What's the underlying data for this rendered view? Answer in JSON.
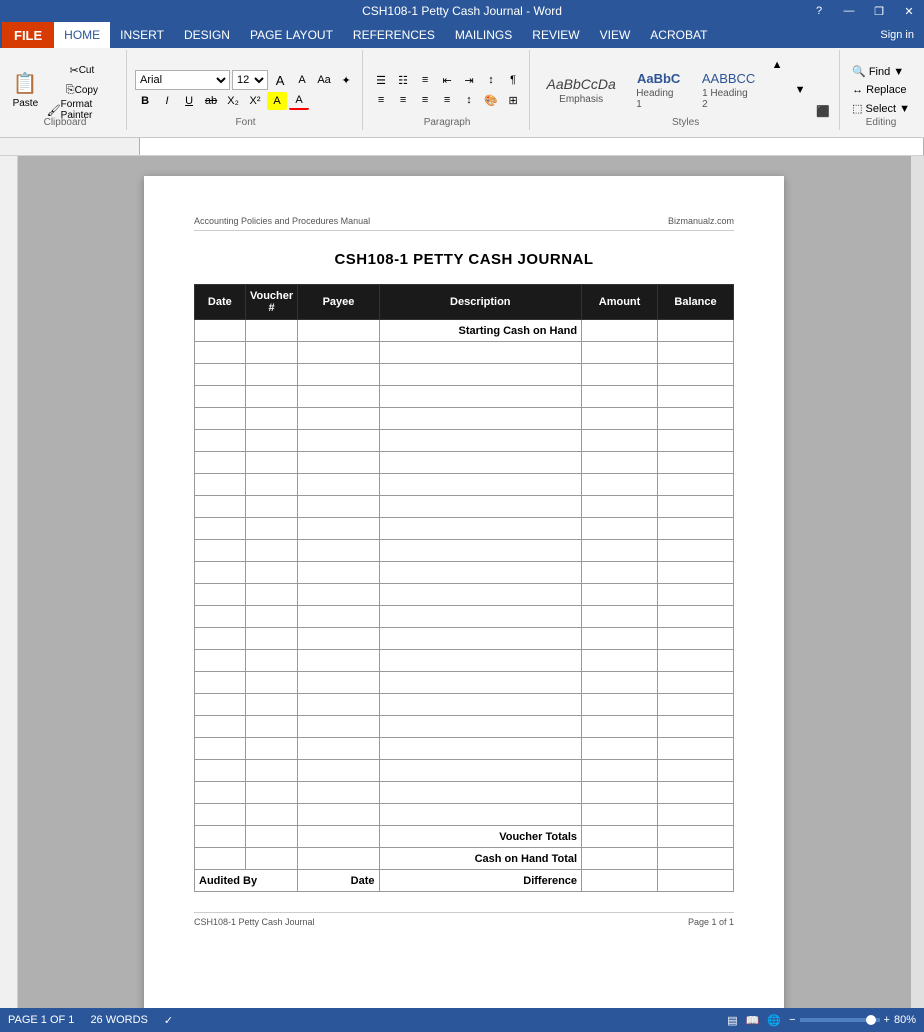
{
  "titleBar": {
    "title": "CSH108-1 Petty Cash Journal - Word",
    "helpBtn": "?",
    "minimizeBtn": "—",
    "restoreBtn": "❐",
    "closeBtn": "✕"
  },
  "menuBar": {
    "file": "FILE",
    "items": [
      "HOME",
      "INSERT",
      "DESIGN",
      "PAGE LAYOUT",
      "REFERENCES",
      "MAILINGS",
      "REVIEW",
      "VIEW",
      "ACROBAT"
    ],
    "signIn": "Sign in"
  },
  "ribbon": {
    "clipboard": {
      "label": "Clipboard",
      "paste": "Paste",
      "cut": "Cut",
      "copy": "Copy",
      "formatPainter": "Format Painter"
    },
    "font": {
      "label": "Font",
      "fontName": "Arial",
      "fontSize": "12",
      "bold": "B",
      "italic": "I",
      "underline": "U"
    },
    "paragraph": {
      "label": "Paragraph"
    },
    "styles": {
      "label": "Styles",
      "emphasis": "Emphasis",
      "heading1": "Heading 1",
      "heading2": "1 Heading 2"
    },
    "editing": {
      "label": "Editing",
      "find": "Find",
      "replace": "Replace",
      "select": "Select"
    }
  },
  "document": {
    "headerLeft": "Accounting Policies and Procedures Manual",
    "headerRight": "Bizmanualz.com",
    "title": "CSH108-1 PETTY CASH JOURNAL",
    "table": {
      "headers": [
        "Date",
        "Voucher #",
        "Payee",
        "Description",
        "Amount",
        "Balance"
      ],
      "specialRow1": "Starting Cash on Hand",
      "voucherTotals": "Voucher Totals",
      "cashOnHandTotal": "Cash on Hand Total",
      "auditedBy": "Audited By",
      "date": "Date",
      "difference": "Difference",
      "emptyRowCount": 22
    },
    "footerLeft": "CSH108-1 Petty Cash Journal",
    "footerRight": "Page 1 of 1"
  },
  "statusBar": {
    "page": "PAGE 1 OF 1",
    "words": "26 WORDS",
    "zoom": "80%",
    "zoomPercent": 80
  }
}
